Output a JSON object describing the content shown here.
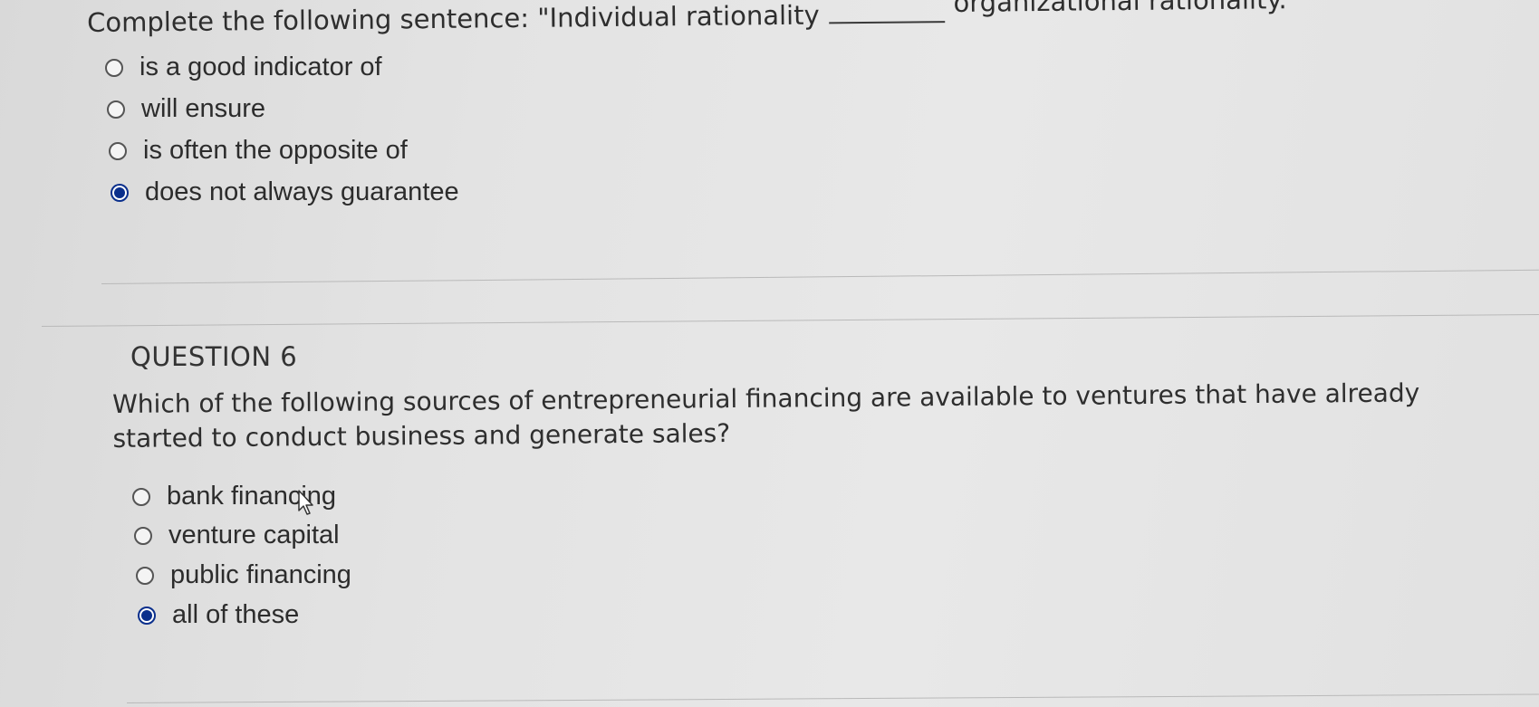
{
  "question5": {
    "prompt_before": "Complete the following sentence: \"Individual rationality",
    "prompt_after": "organizational rationality.\"",
    "options": [
      {
        "label": "is a good indicator of",
        "selected": false
      },
      {
        "label": "will ensure",
        "selected": false
      },
      {
        "label": "is often the opposite of",
        "selected": false
      },
      {
        "label": "does not always guarantee",
        "selected": true
      }
    ]
  },
  "question6": {
    "heading": "QUESTION 6",
    "text": "Which of the following sources of entrepreneurial financing are available to ventures that have already started to conduct business and generate sales?",
    "options": [
      {
        "label": "bank financing",
        "selected": false
      },
      {
        "label": "venture capital",
        "selected": false
      },
      {
        "label": "public financing",
        "selected": false
      },
      {
        "label": "all of these",
        "selected": true
      }
    ]
  },
  "colors": {
    "selected_radio": "#0a2f8c",
    "text": "#2c2c2c",
    "background": "#e3e3e3"
  },
  "icons": {
    "cursor": "mouse-pointer-icon"
  }
}
